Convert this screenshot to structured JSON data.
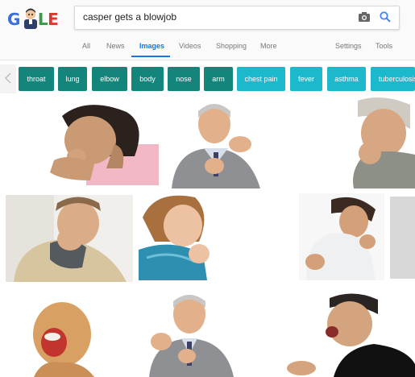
{
  "logo": {
    "text": [
      "G",
      "L",
      "E"
    ],
    "colors": {
      "blue": "#3b6fd8",
      "red": "#d93a2e",
      "yellow": "#f1b32c",
      "green": "#3a9a49"
    }
  },
  "search": {
    "query": "casper gets a blowjob"
  },
  "nav": {
    "tabs": [
      "All",
      "News",
      "Images",
      "Videos",
      "Shopping",
      "More"
    ],
    "active": "Images",
    "right": [
      "Settings",
      "Tools"
    ]
  },
  "chips": [
    "throat",
    "lung",
    "elbow",
    "body",
    "nose",
    "arm",
    "chest pain",
    "fever",
    "asthma",
    "tuberculosis"
  ],
  "colors": {
    "accent": "#1a73e8",
    "chip_dark": "#13857b",
    "chip_light": "#1cb9cc"
  },
  "images": [
    {
      "name": "woman-coughing"
    },
    {
      "name": "older-man-coughing"
    },
    {
      "name": "man-scarf-coughing"
    },
    {
      "name": "man-beige-sweater-coughing"
    },
    {
      "name": "woman-blue-scarf-coughing"
    },
    {
      "name": "man-white-shirt-coughing"
    },
    {
      "name": "gray-thumbnail"
    },
    {
      "name": "bald-man-yelling"
    },
    {
      "name": "older-man-coughing-2"
    },
    {
      "name": "man-dark-shirt-coughing"
    }
  ]
}
